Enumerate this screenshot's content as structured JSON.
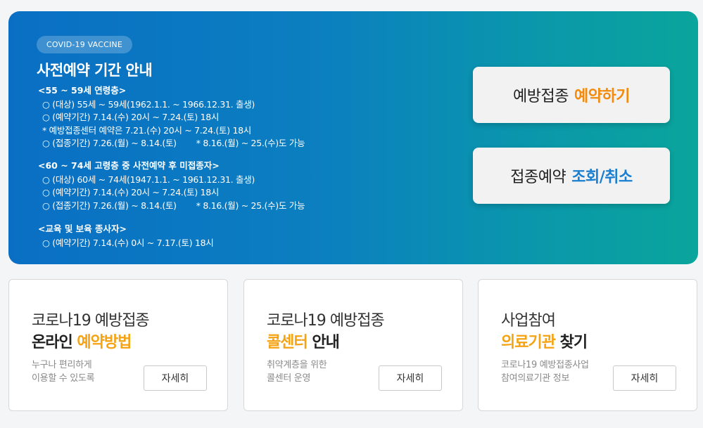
{
  "hero": {
    "badge": "COVID-19 VACCINE",
    "title": "사전예약 기간 안내",
    "groups": [
      {
        "title": "<55 ~ 59세 연령층>",
        "lines": [
          "○ (대상) 55세 ~ 59세(1962.1.1. ~ 1966.12.31. 출생)",
          "○ (예약기간) 7.14.(수) 20시 ~ 7.24.(토) 18시",
          "* 예방접종센터 예약은 7.21.(수) 20시 ~ 7.24.(토) 18시",
          "○ (접종기간) 7.26.(월) ~ 8.14.(토)"
        ],
        "extra": "* 8.16.(월) ~ 25.(수)도 가능"
      },
      {
        "title": "<60 ~ 74세 고령층 중 사전예약 후 미접종자>",
        "lines": [
          "○ (대상) 60세 ~ 74세(1947.1.1. ~ 1961.12.31. 출생)",
          "○ (예약기간) 7.14.(수) 20시 ~ 7.24.(토) 18시",
          "○ (접종기간) 7.26.(월) ~ 8.14.(토)"
        ],
        "extra": "* 8.16.(월) ~ 25.(수)도 가능"
      },
      {
        "title": "<교육 및 보육 종사자>",
        "lines": [
          "○ (예약기간) 7.14.(수) 0시 ~ 7.17.(토) 18시"
        ]
      }
    ]
  },
  "cta": {
    "reserve_prefix": "예방접종",
    "reserve_accent": "예약하기",
    "lookup_prefix": "접종예약",
    "lookup_accent": "조회/취소"
  },
  "cards": [
    {
      "line1": "코로나19 예방접종",
      "line2_plain": "온라인 ",
      "line2_highlight": "예약방법",
      "line2_suffix": "",
      "desc1": "누구나 편리하게",
      "desc2": "이용할 수 있도록",
      "button": "자세히"
    },
    {
      "line1": "코로나19 예방접종",
      "line2_plain": "",
      "line2_highlight": "콜센터",
      "line2_suffix": " 안내",
      "desc1": "취약계층을 위한",
      "desc2": "콜센터 운영",
      "button": "자세히"
    },
    {
      "line1": "사업참여",
      "line2_plain": "",
      "line2_highlight": "의료기관",
      "line2_suffix": " 찾기",
      "desc1": "코로나19 예방접종사업",
      "desc2": "참여의료기관 정보",
      "button": "자세히"
    }
  ],
  "colors": {
    "hero_gradient_start": "#0a6fc4",
    "hero_gradient_end": "#0aa59c",
    "accent_orange": "#f28a0c",
    "accent_blue": "#1a7fd1",
    "card_highlight": "#f5a313"
  }
}
